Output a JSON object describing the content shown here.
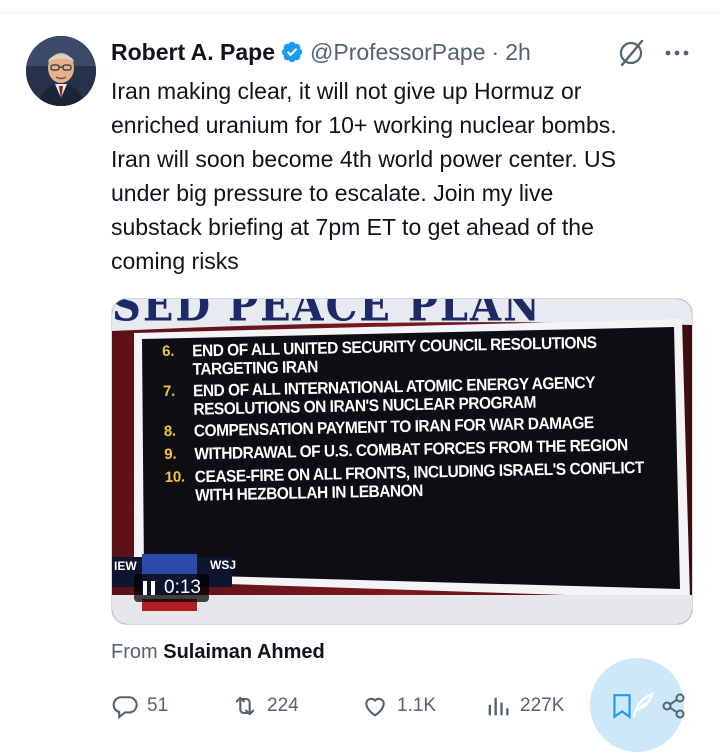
{
  "tweet": {
    "author": {
      "display_name": "Robert A. Pape",
      "handle": "@ProfessorPape",
      "separator": "·",
      "time": "2h",
      "verified": true
    },
    "text_lines": [
      "Iran making clear, it will not give up Hormuz or",
      "enriched uranium for 10+ working nuclear bombs.",
      "Iran will soon become 4th world power center. US",
      "under big pressure to escalate. Join my live",
      "substack briefing at 7pm ET to get ahead of the",
      "coming risks"
    ],
    "media": {
      "headline": "SED PEACE PLAN",
      "items": [
        {
          "num": "6.",
          "text": "End of all United Security Council resolutions targeting Iran"
        },
        {
          "num": "7.",
          "text": "End of all International Atomic Energy Agency resolutions on Iran's nuclear program"
        },
        {
          "num": "8.",
          "text": "Compensation payment to Iran for war damage"
        },
        {
          "num": "9.",
          "text": "Withdrawal of U.S. combat forces from the region"
        },
        {
          "num": "10.",
          "text": "Cease-fire on all fronts, including Israel's conflict with Hezbollah in Lebanon"
        }
      ],
      "news_label": "IEW",
      "source_label": "WSJ",
      "timer": "0:13"
    },
    "from": {
      "prefix": "From",
      "name": "Sulaiman Ahmed"
    },
    "actions": {
      "replies": "51",
      "reposts": "224",
      "likes": "1.1K",
      "views": "227K"
    },
    "colors": {
      "verified_blue": "#1d9bf0",
      "secondary_text": "#536471",
      "plan_number": "#f3c43b"
    },
    "icons": [
      "verified-badge-icon",
      "grok-icon",
      "more-icon",
      "pause-icon",
      "reply-icon",
      "repost-icon",
      "like-icon",
      "views-icon",
      "bookmark-icon",
      "share-icon"
    ]
  }
}
